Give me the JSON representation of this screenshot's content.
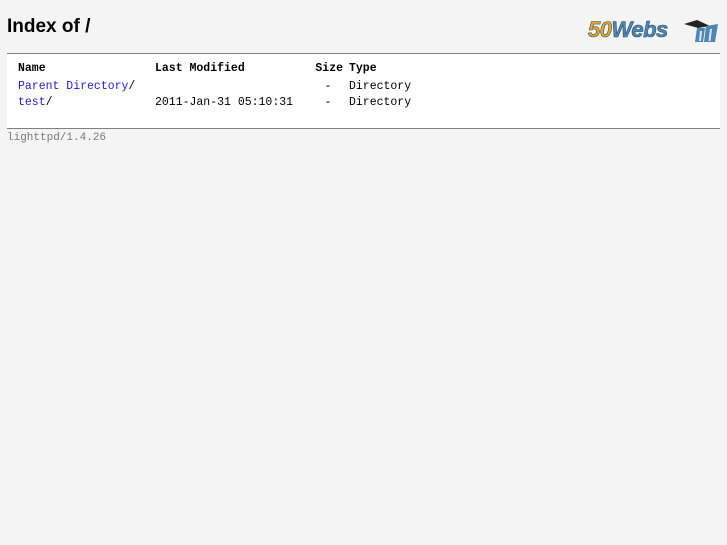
{
  "page": {
    "title": "Index of /"
  },
  "logo": {
    "text": "50Webs",
    "icon": "50webs-logo-icon"
  },
  "listing": {
    "headers": {
      "name": "Name",
      "modified": "Last Modified",
      "size": "Size",
      "type": "Type"
    },
    "rows": [
      {
        "name": "Parent Directory",
        "slash": "/",
        "modified": "",
        "size": "-",
        "type": "Directory"
      },
      {
        "name": "test",
        "slash": "/",
        "modified": "2011-Jan-31 05:10:31",
        "size": "-",
        "type": "Directory"
      }
    ]
  },
  "footer": {
    "server": "lighttpd/1.4.26"
  },
  "colors": {
    "background": "#f4f4f4",
    "link": "#2121c6",
    "footer_text": "#787878",
    "logo_orange": "#e8a820",
    "logo_blue": "#4f86b5"
  }
}
